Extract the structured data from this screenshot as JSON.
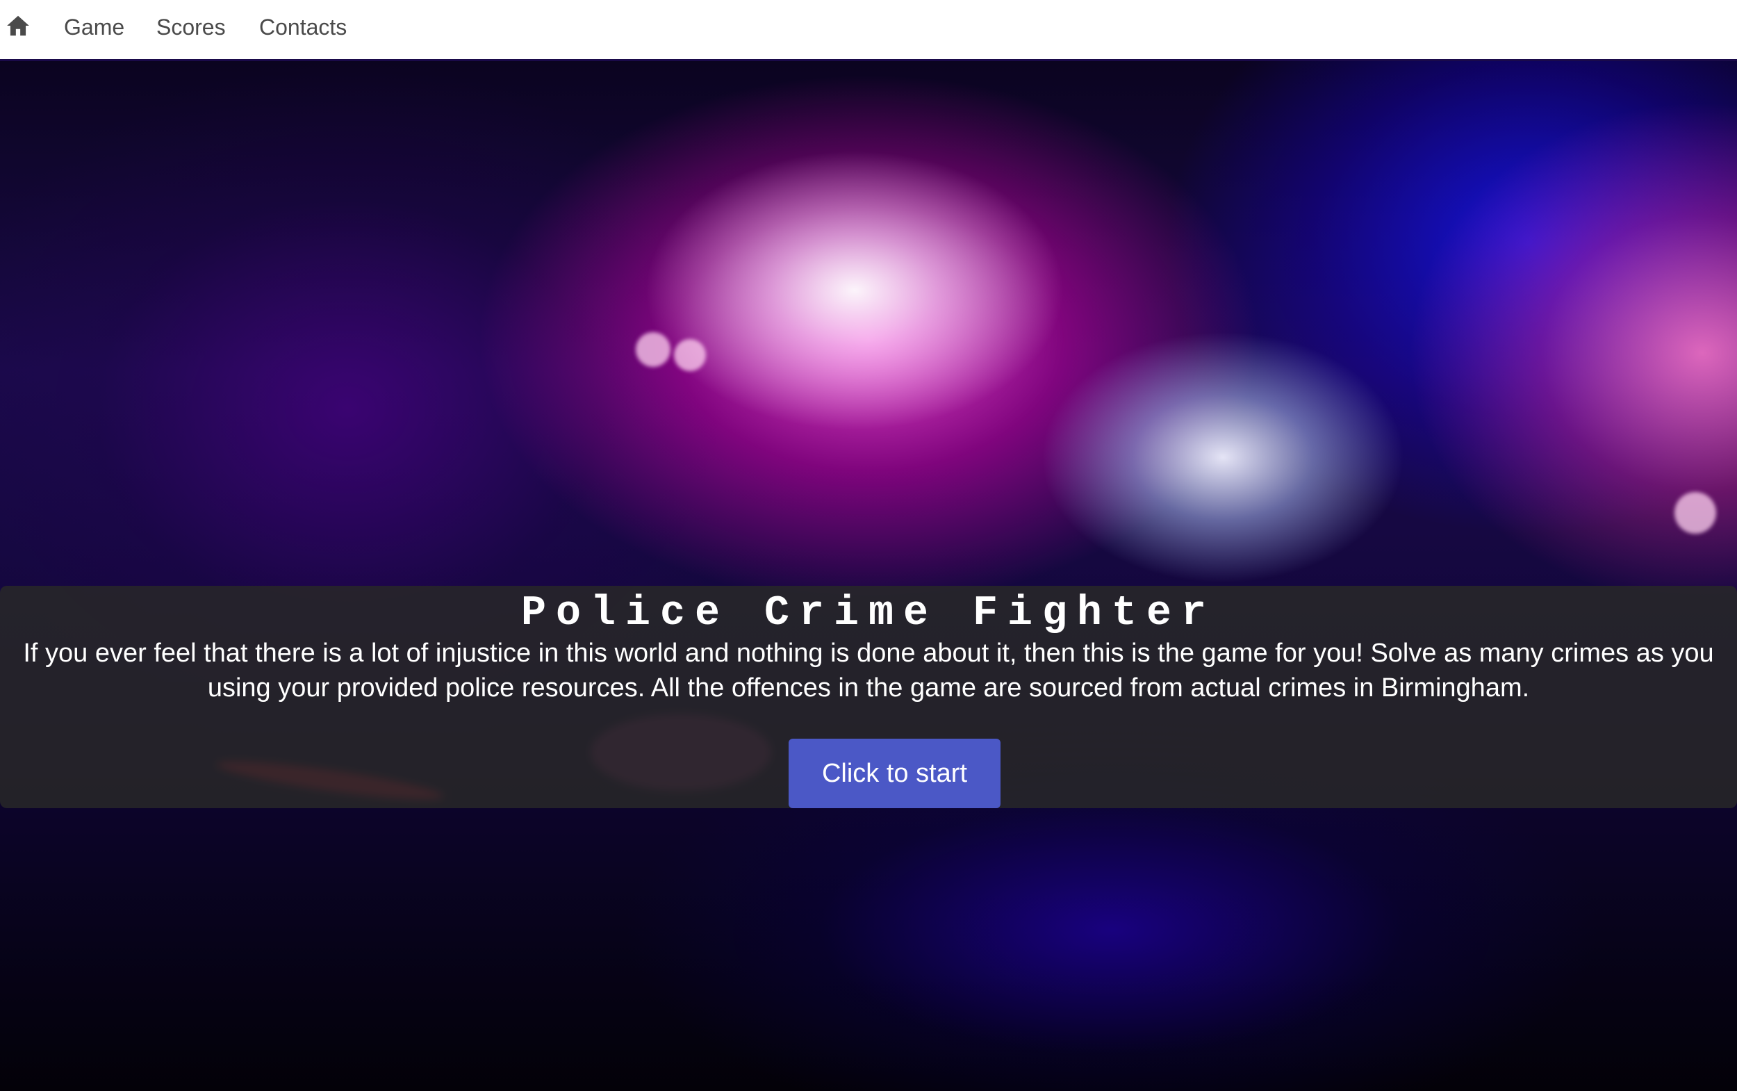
{
  "nav": {
    "home_icon": "home-icon",
    "items": [
      {
        "label": "Game"
      },
      {
        "label": "Scores"
      },
      {
        "label": "Contacts"
      }
    ]
  },
  "hero": {
    "title": "Police Crime Fighter",
    "description_line1": "If you ever feel that there is a lot of injustice in this world and nothing is done about it, then this is the game for you! Solve as many crimes as you",
    "description_line2": "using your provided police resources. All the offences in the game are sourced from actual crimes in Birmingham.",
    "start_button_label": "Click to start"
  },
  "colors": {
    "button": "#4b58c6",
    "overlay": "#282828",
    "nav_text": "#4a4a4a"
  }
}
